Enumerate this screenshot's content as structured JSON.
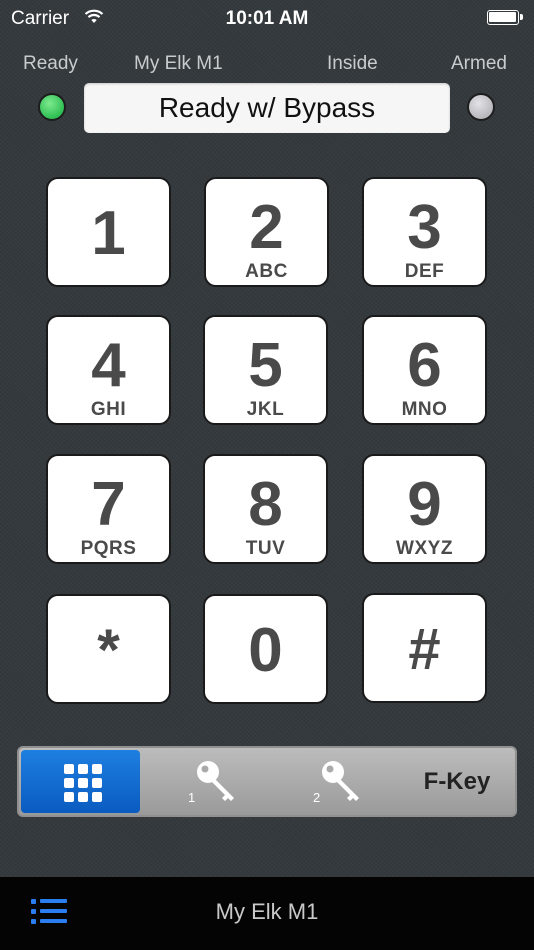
{
  "status_bar": {
    "carrier": "Carrier",
    "time": "10:01 AM"
  },
  "header": {
    "ready_label": "Ready",
    "panel_name": "My Elk M1",
    "mode_label": "Inside",
    "armed_label": "Armed",
    "display_text": "Ready w/ Bypass",
    "ready_led_color": "#3fcf5f",
    "armed_led_color": "#c8c8cc"
  },
  "keypad": {
    "keys": [
      {
        "digit": "1",
        "letters": ""
      },
      {
        "digit": "2",
        "letters": "ABC"
      },
      {
        "digit": "3",
        "letters": "DEF"
      },
      {
        "digit": "4",
        "letters": "GHI"
      },
      {
        "digit": "5",
        "letters": "JKL"
      },
      {
        "digit": "6",
        "letters": "MNO"
      },
      {
        "digit": "7",
        "letters": "PQRS"
      },
      {
        "digit": "8",
        "letters": "TUV"
      },
      {
        "digit": "9",
        "letters": "WXYZ"
      },
      {
        "digit": "*",
        "letters": ""
      },
      {
        "digit": "0",
        "letters": ""
      },
      {
        "digit": "#",
        "letters": ""
      }
    ]
  },
  "segments": {
    "keypad_icon": "grid-icon",
    "key1_icon": "key-icon",
    "key1_number": "1",
    "key2_icon": "key-icon",
    "key2_number": "2",
    "fkey_label": "F-Key",
    "active_color": "#1470d8"
  },
  "bottom_bar": {
    "title": "My Elk M1",
    "menu_icon": "list-icon"
  }
}
